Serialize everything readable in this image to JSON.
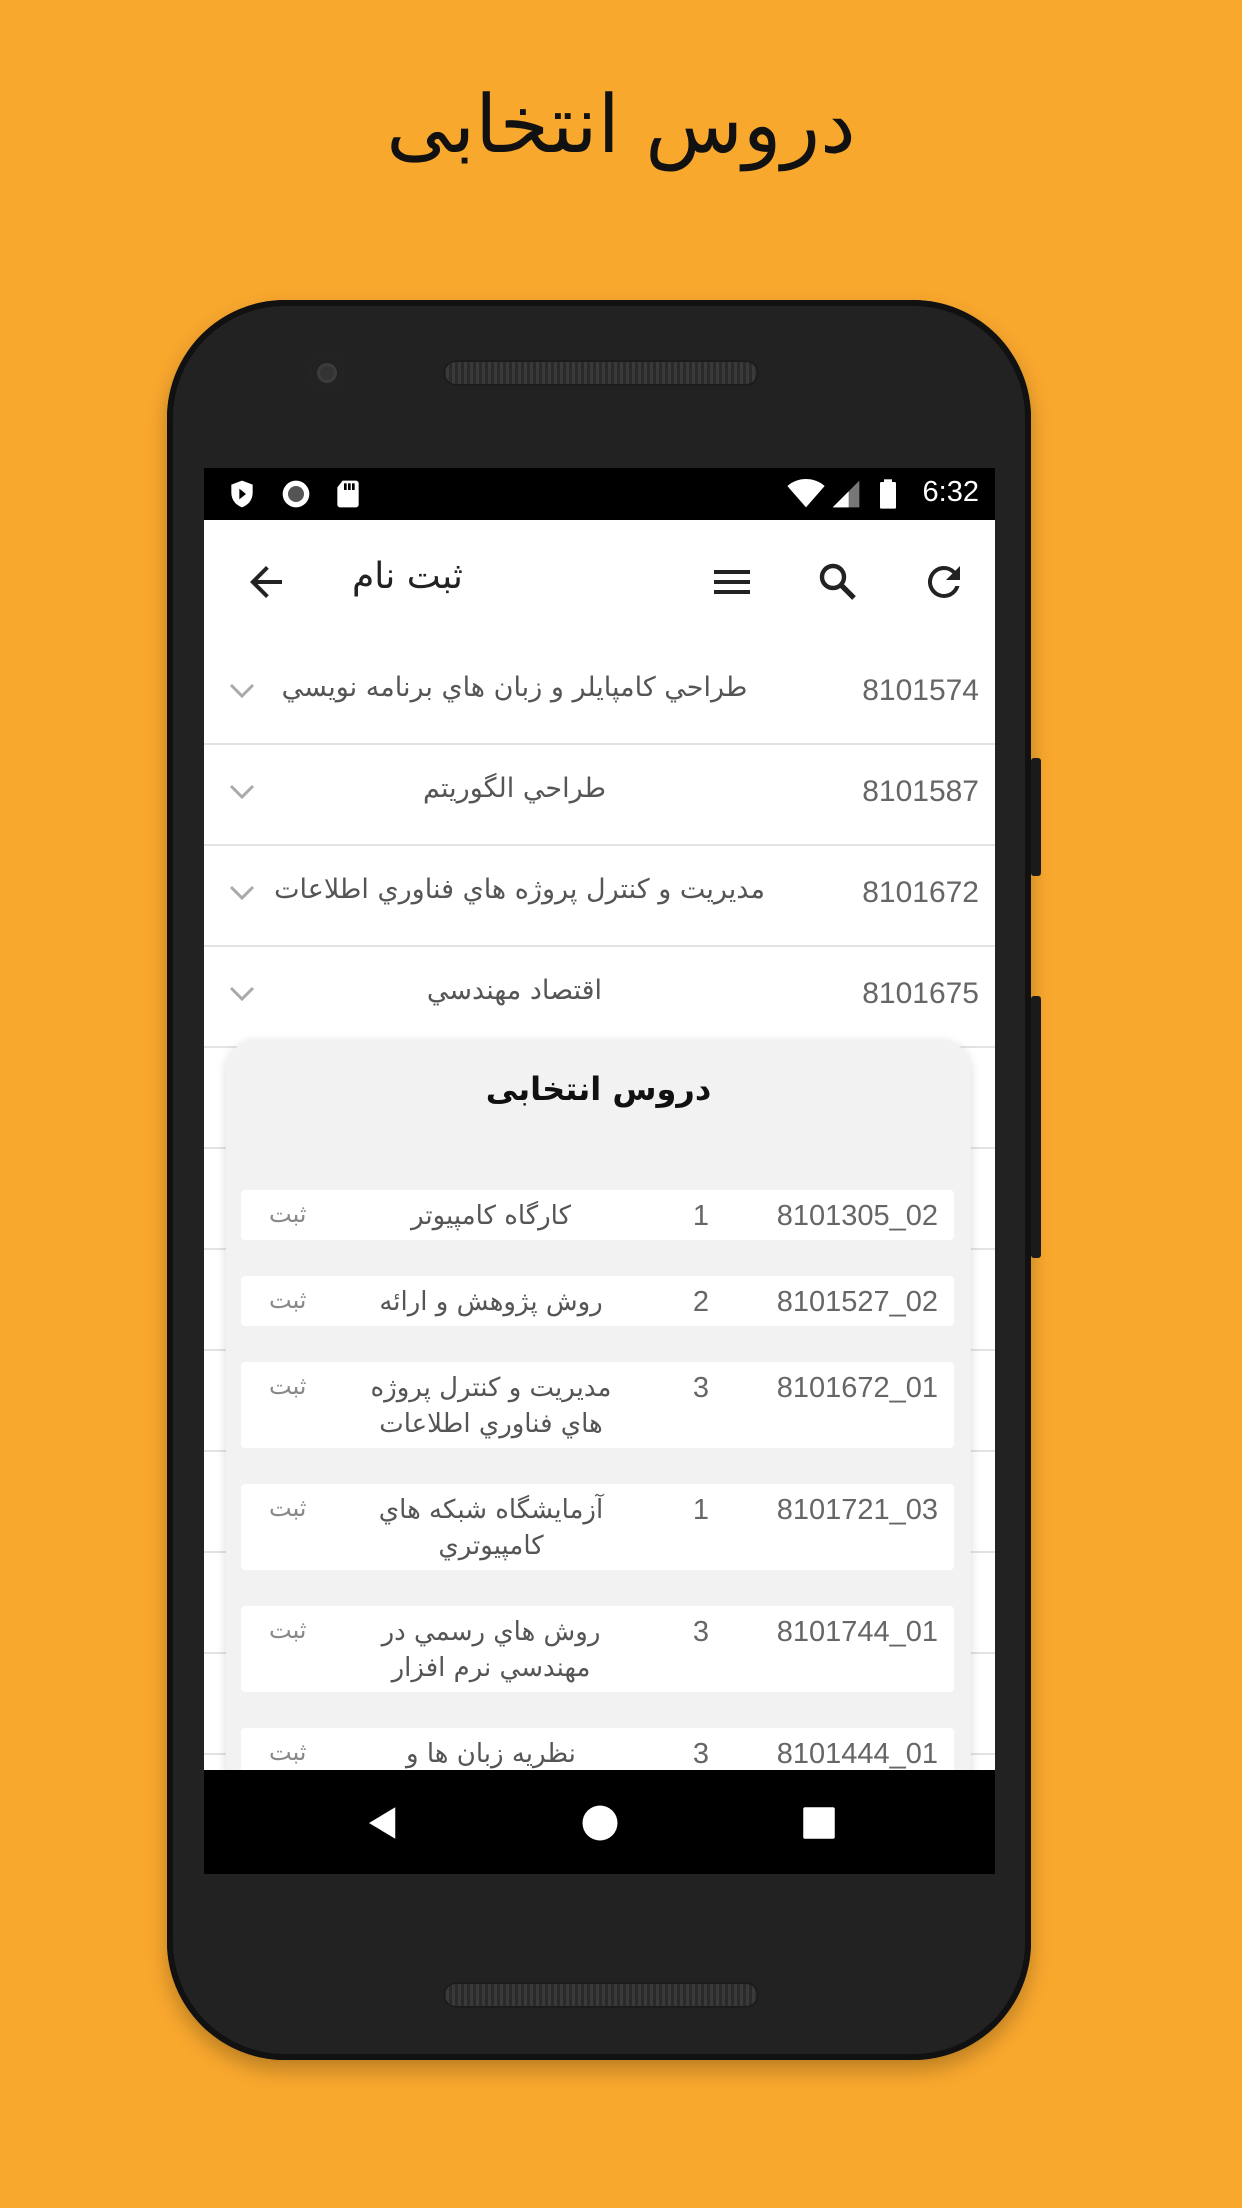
{
  "headline": "دروس انتخابی",
  "status_bar": {
    "time": "6:32",
    "icons": [
      "shield-icon",
      "circle-record-icon",
      "sd-card-icon",
      "wifi-icon",
      "signal-icon",
      "battery-icon"
    ]
  },
  "toolbar": {
    "title": "ثبت نام",
    "back_icon": "arrow-back-icon",
    "menu_icon": "menu-icon",
    "search_icon": "search-icon",
    "refresh_icon": "refresh-icon"
  },
  "course_list": [
    {
      "code": "8101574",
      "name": "طراحي كامپايلر و زبان هاي برنامه نويسي"
    },
    {
      "code": "8101587",
      "name": "طراحي الگوريتم"
    },
    {
      "code": "8101672",
      "name": "مديريت و كنترل پروژه هاي فناوري اطلاعات"
    },
    {
      "code": "8101675",
      "name": "اقتصاد مهندسي"
    }
  ],
  "dialog": {
    "title": "دروس انتخابی",
    "rows": [
      {
        "code": "8101305_02",
        "units": "1",
        "name": "كارگاه كامپيوتر",
        "action": "ثبت"
      },
      {
        "code": "8101527_02",
        "units": "2",
        "name": "روش پژوهش و ارائه",
        "action": "ثبت"
      },
      {
        "code": "8101672_01",
        "units": "3",
        "name": "مديريت و كنترل پروژه هاي فناوري اطلاعات",
        "action": "ثبت"
      },
      {
        "code": "8101721_03",
        "units": "1",
        "name": "آزمايشگاه شبكه هاي كامپيوتري",
        "action": "ثبت"
      },
      {
        "code": "8101744_01",
        "units": "3",
        "name": "روش هاي رسمي در مهندسي نرم افزار",
        "action": "ثبت"
      },
      {
        "code": "8101444_01",
        "units": "3",
        "name": "نظريه زبان ها و",
        "action": "ثبت"
      }
    ]
  },
  "colors": {
    "background": "#F9A82E",
    "phone_body": "#222222",
    "dialog_bg": "#F2F2F2"
  }
}
